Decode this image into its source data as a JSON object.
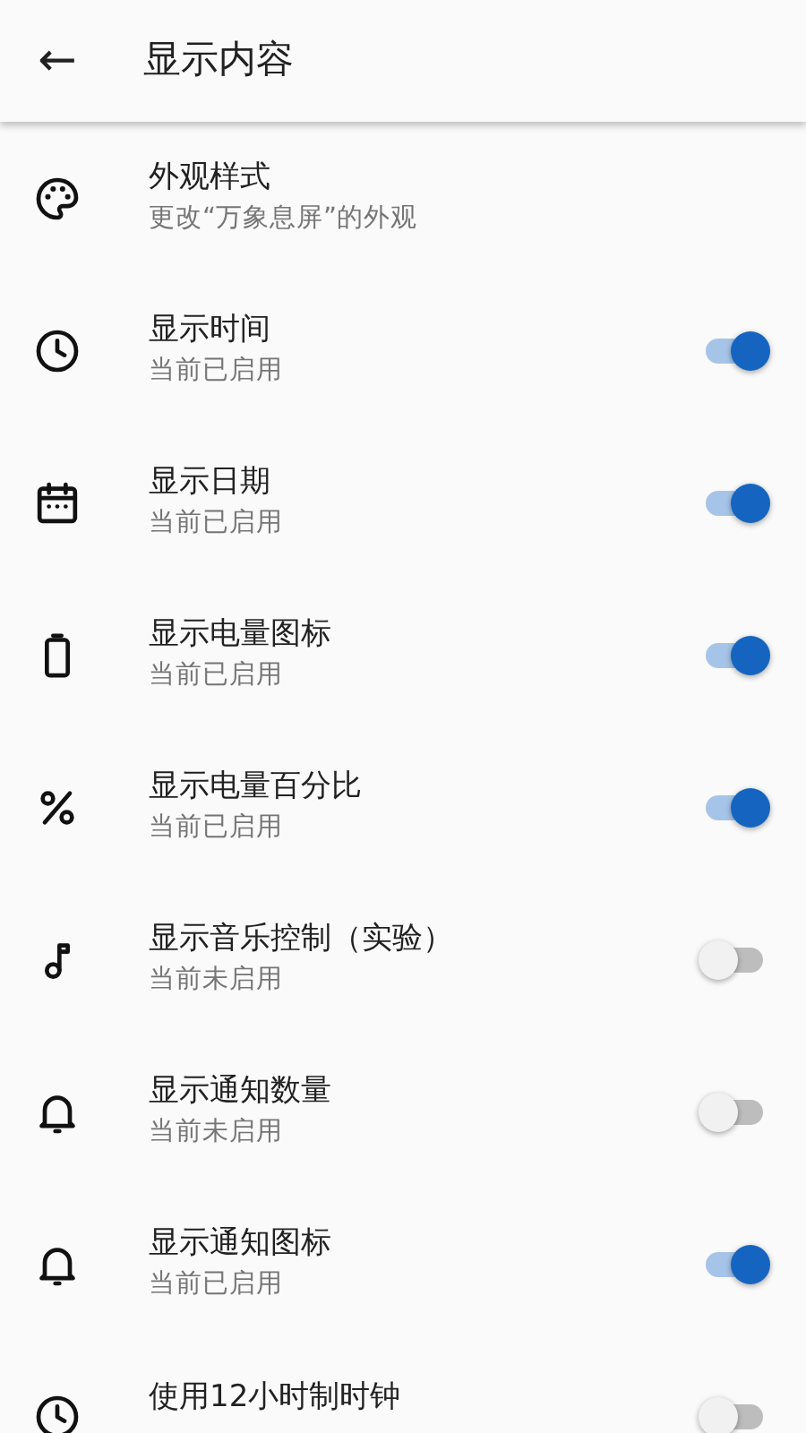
{
  "app_bar": {
    "back": "←",
    "title": "显示内容"
  },
  "items": [
    {
      "kind": "link",
      "title": "外观样式",
      "subtitle": "更改“万象息屏”的外观"
    },
    {
      "kind": "toggle",
      "title": "显示时间",
      "subtitle": "当前已启用",
      "on": true
    },
    {
      "kind": "toggle",
      "title": "显示日期",
      "subtitle": "当前已启用",
      "on": true
    },
    {
      "kind": "toggle",
      "title": "显示电量图标",
      "subtitle": "当前已启用",
      "on": true
    },
    {
      "kind": "toggle",
      "title": "显示电量百分比",
      "subtitle": "当前已启用",
      "on": true
    },
    {
      "kind": "toggle",
      "title": "显示音乐控制（实验）",
      "subtitle": "当前未启用",
      "on": false
    },
    {
      "kind": "toggle",
      "title": "显示通知数量",
      "subtitle": "当前未启用",
      "on": false
    },
    {
      "kind": "toggle",
      "title": "显示通知图标",
      "subtitle": "当前已启用",
      "on": true
    },
    {
      "kind": "toggle",
      "title": "使用12小时制时钟",
      "on": false
    }
  ]
}
